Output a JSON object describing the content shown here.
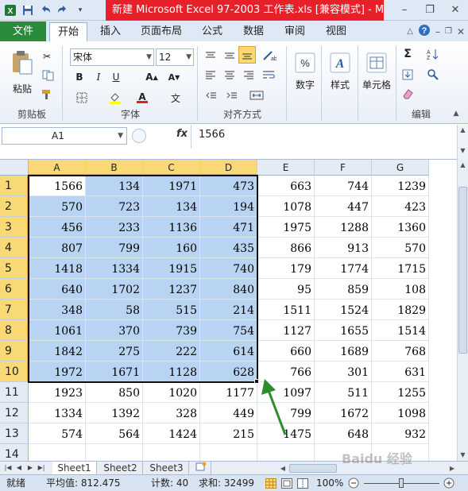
{
  "window": {
    "title": "新建 Microsoft Excel 97-2003 工作表.xls  [兼容模式] - Mi..."
  },
  "ribbon": {
    "file_tab": "文件",
    "tabs": [
      "开始",
      "插入",
      "页面布局",
      "公式",
      "数据",
      "审阅",
      "视图"
    ],
    "active_tab": "开始",
    "clipboard": {
      "paste": "粘贴",
      "label": "剪贴板"
    },
    "font": {
      "name": "宋体",
      "size": "12",
      "label": "字体",
      "bold": "B",
      "italic": "I",
      "underline": "U"
    },
    "alignment": {
      "label": "对齐方式"
    },
    "number": {
      "button": "数字"
    },
    "styles": {
      "button": "样式"
    },
    "cells": {
      "button": "单元格"
    },
    "editing": {
      "label": "编辑",
      "sum": "Σ"
    }
  },
  "formula_bar": {
    "name_box": "A1",
    "fx": "fx",
    "value": "1566"
  },
  "sheet": {
    "columns": [
      "A",
      "B",
      "C",
      "D",
      "E",
      "F",
      "G"
    ],
    "selected_columns": [
      "A",
      "B",
      "C",
      "D"
    ],
    "rows": [
      {
        "n": "1",
        "cells": [
          "1566",
          "134",
          "1971",
          "473",
          "663",
          "744",
          "1239"
        ]
      },
      {
        "n": "2",
        "cells": [
          "570",
          "723",
          "134",
          "194",
          "1078",
          "447",
          "423"
        ]
      },
      {
        "n": "3",
        "cells": [
          "456",
          "233",
          "1136",
          "471",
          "1975",
          "1288",
          "1360"
        ]
      },
      {
        "n": "4",
        "cells": [
          "807",
          "799",
          "160",
          "435",
          "866",
          "913",
          "570"
        ]
      },
      {
        "n": "5",
        "cells": [
          "1418",
          "1334",
          "1915",
          "740",
          "179",
          "1774",
          "1715"
        ]
      },
      {
        "n": "6",
        "cells": [
          "640",
          "1702",
          "1237",
          "840",
          "95",
          "859",
          "108"
        ]
      },
      {
        "n": "7",
        "cells": [
          "348",
          "58",
          "515",
          "214",
          "1511",
          "1524",
          "1829"
        ]
      },
      {
        "n": "8",
        "cells": [
          "1061",
          "370",
          "739",
          "754",
          "1127",
          "1655",
          "1514"
        ]
      },
      {
        "n": "9",
        "cells": [
          "1842",
          "275",
          "222",
          "614",
          "660",
          "1689",
          "768"
        ]
      },
      {
        "n": "10",
        "cells": [
          "1972",
          "1671",
          "1128",
          "628",
          "766",
          "301",
          "631"
        ]
      },
      {
        "n": "11",
        "cells": [
          "1923",
          "850",
          "1020",
          "1177",
          "1097",
          "511",
          "1255"
        ]
      },
      {
        "n": "12",
        "cells": [
          "1334",
          "1392",
          "328",
          "449",
          "799",
          "1672",
          "1098"
        ]
      },
      {
        "n": "13",
        "cells": [
          "574",
          "564",
          "1424",
          "215",
          "1475",
          "648",
          "932"
        ]
      },
      {
        "n": "14",
        "cells": [
          "",
          "",
          "",
          "",
          "",
          "",
          ""
        ]
      }
    ],
    "selection": "A1:D10",
    "arrow_color": "#2e8b2e",
    "selection_fill": "#b9d4f2",
    "header_highlight": "#f9d976"
  },
  "sheet_tabs": [
    "Sheet1",
    "Sheet2",
    "Sheet3"
  ],
  "active_sheet": "Sheet1",
  "status": {
    "ready": "就绪",
    "average": "平均值: 812.475",
    "count": "计数: 40",
    "sum": "求和: 32499",
    "zoom": "100%"
  },
  "watermark": "Baidu 经验"
}
